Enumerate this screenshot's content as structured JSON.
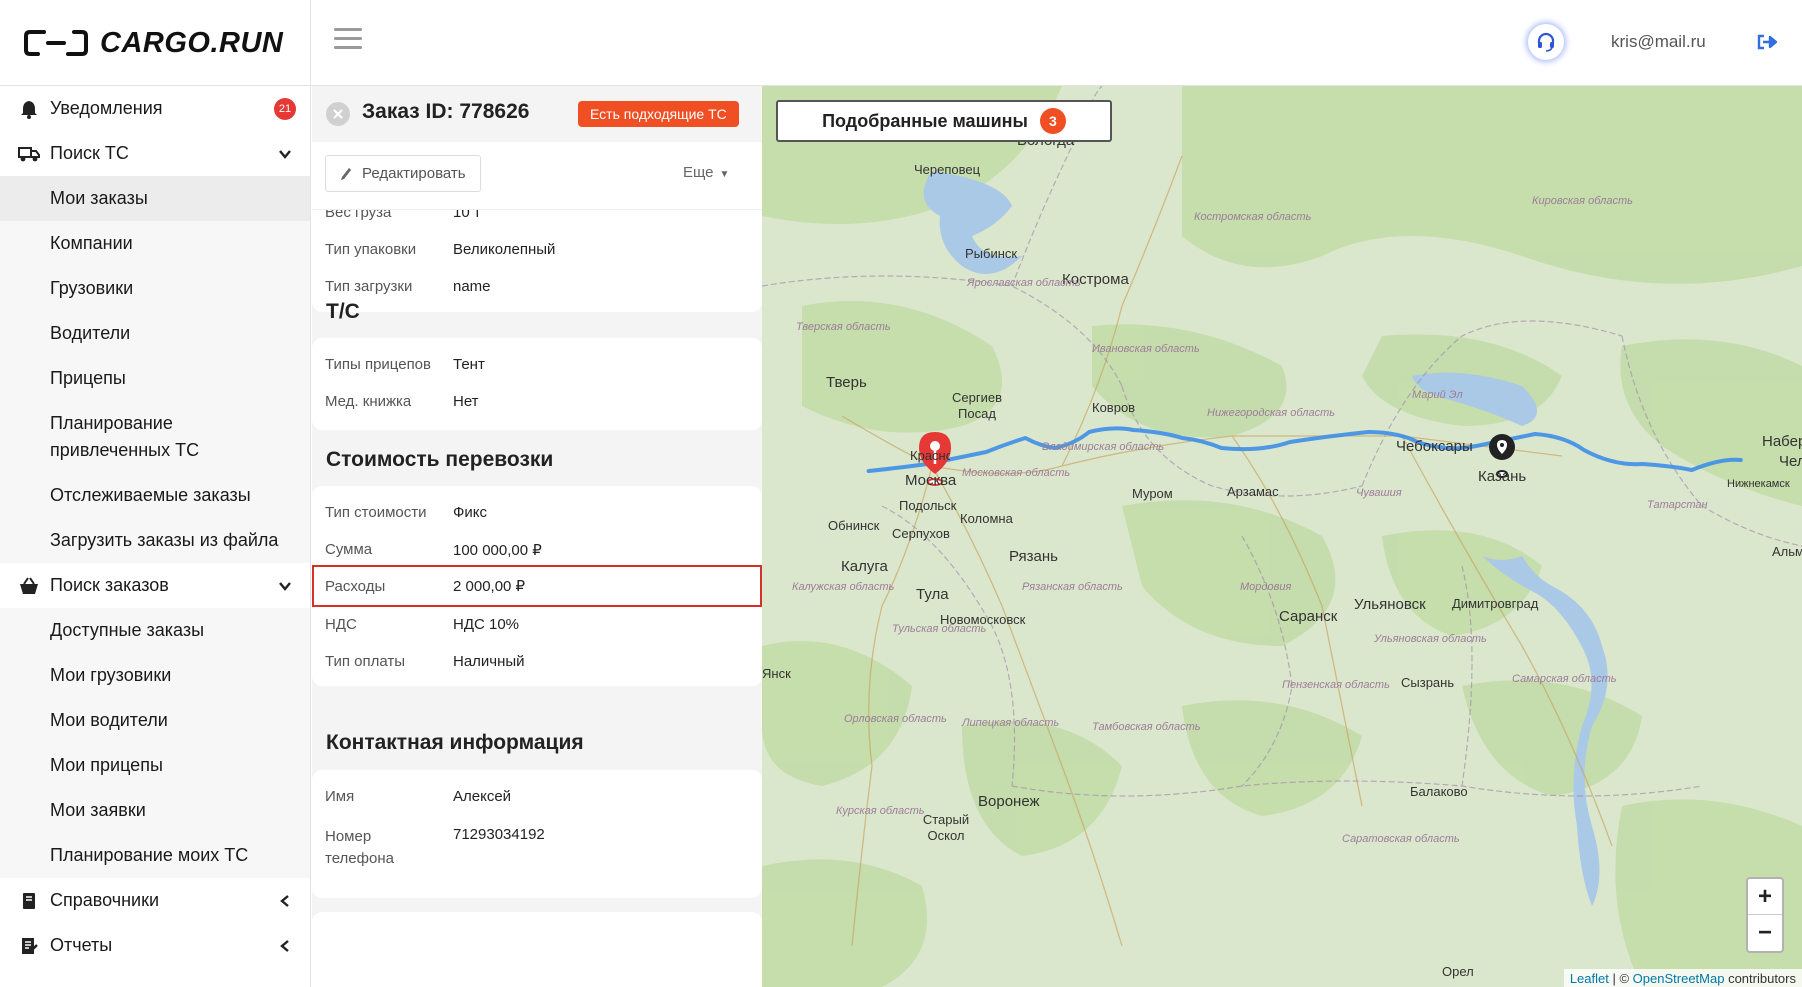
{
  "header": {
    "logo_text": "CARGO.RUN",
    "user_email": "kris@mail.ru",
    "icons": {
      "menu": "hamburger-icon",
      "support": "headset-icon",
      "logout": "logout-icon"
    }
  },
  "sidebar": {
    "items": [
      {
        "label": "Уведомления",
        "icon": "bell-icon",
        "badge": "21"
      },
      {
        "label": "Поиск ТС",
        "icon": "truck-icon",
        "expanded": true
      },
      {
        "label": "Мои заказы",
        "sub": true,
        "active": true
      },
      {
        "label": "Компании",
        "sub": true
      },
      {
        "label": "Грузовики",
        "sub": true
      },
      {
        "label": "Водители",
        "sub": true
      },
      {
        "label": "Прицепы",
        "sub": true
      },
      {
        "label": "Планирование привлеченных ТС",
        "sub": true
      },
      {
        "label": "Отслеживаемые заказы",
        "sub": true
      },
      {
        "label": "Загрузить заказы из файла",
        "sub": true
      },
      {
        "label": "Поиск заказов",
        "icon": "basket-icon",
        "expanded": true
      },
      {
        "label": "Доступные заказы",
        "sub": true
      },
      {
        "label": "Мои грузовики",
        "sub": true
      },
      {
        "label": "Мои водители",
        "sub": true
      },
      {
        "label": "Мои прицепы",
        "sub": true
      },
      {
        "label": "Мои заявки",
        "sub": true
      },
      {
        "label": "Планирование моих ТС",
        "sub": true
      },
      {
        "label": "Справочники",
        "icon": "book-icon",
        "expanded": false
      },
      {
        "label": "Отчеты",
        "icon": "report-icon",
        "expanded": false
      }
    ]
  },
  "order": {
    "title": "Заказ ID: 778626",
    "match_badge": "Есть подходящие ТС",
    "edit_label": "Редактировать",
    "more_label": "Еще",
    "cargo": {
      "partial_label": "Вес груза",
      "partial_value": "10 т",
      "rows": [
        {
          "label": "Тип упаковки",
          "value": "Великолепный"
        },
        {
          "label": "Тип загрузки",
          "value": "name"
        }
      ]
    },
    "vehicle": {
      "header": "Т/С",
      "rows": [
        {
          "label": "Типы прицепов",
          "value": "Тент"
        },
        {
          "label": "Мед. книжка",
          "value": "Нет"
        }
      ]
    },
    "cost": {
      "header": "Стоимость перевозки",
      "rows": [
        {
          "label": "Тип стоимости",
          "value": "Фикс"
        },
        {
          "label": "Сумма",
          "value": "100 000,00 ₽"
        },
        {
          "label": "Расходы",
          "value": "2 000,00 ₽",
          "highlight": true
        },
        {
          "label": "НДС",
          "value": "НДС 10%"
        },
        {
          "label": "Тип оплаты",
          "value": "Наличный"
        }
      ]
    },
    "contact": {
      "header": "Контактная информация",
      "rows": [
        {
          "label": "Имя",
          "value": "Алексей"
        },
        {
          "label": "Номер телефона",
          "value": "71293034192"
        }
      ]
    }
  },
  "map": {
    "cars_button": "Подобранные машины",
    "cars_count": "3",
    "zoom_in": "+",
    "zoom_out": "−",
    "attribution": {
      "leaflet": "Leaflet",
      "sep": " | © ",
      "osm": "OpenStreetMap",
      "contrib": " contributors"
    },
    "route_color": "#3d8ee8",
    "origin_marker_color": "#e53935",
    "destination_marker_color": "#222222",
    "cities": [
      "Вологда",
      "Череповец",
      "Рыбинск",
      "Кострома",
      "Тверь",
      "Сергиев Посад",
      "Ковров",
      "Краснодар",
      "Москва",
      "Подольск",
      "Муром",
      "Арзамас",
      "Чебоксары",
      "Казань",
      "Обнинск",
      "Серпухов",
      "Коломна",
      "Калуга",
      "Рязань",
      "Тула",
      "Новомосковск",
      "Саранск",
      "Ульяновск",
      "Димитровград",
      "Сызрань",
      "Балаково",
      "Воронеж",
      "Старый Оскол",
      "Набере",
      "Челн",
      "Нижнекамск",
      "Альметь",
      "Янск",
      "Орел"
    ],
    "regions": [
      "Кировская область",
      "Костромская область",
      "Ярославская область",
      "Тверская область",
      "Ивановская область",
      "Нижегородская область",
      "Марий Эл",
      "Владимирская область",
      "Московская область",
      "Чувашия",
      "Татарстан",
      "Калужская область",
      "Рязанская область",
      "Мордовия",
      "Тульская область",
      "Ульяновская область",
      "Пензенская область",
      "Самарская область",
      "Орловская область",
      "Липецкая область",
      "Тамбовская область",
      "Курская область",
      "Саратовская область"
    ]
  }
}
